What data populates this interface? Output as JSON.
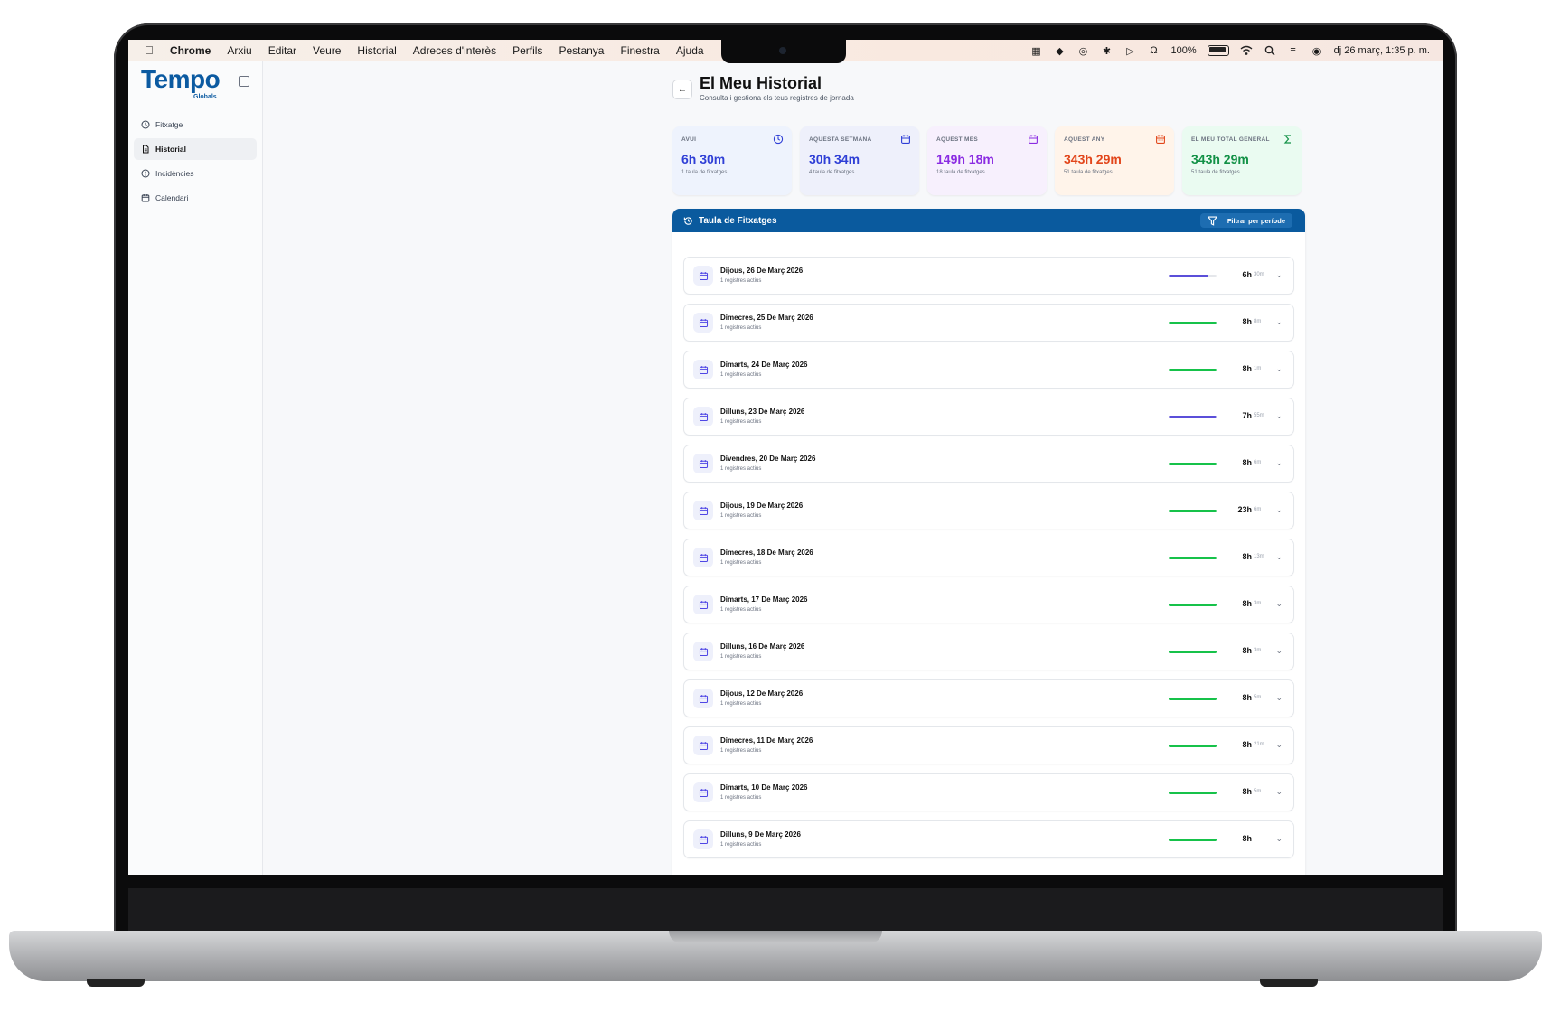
{
  "menubar": {
    "app": "Chrome",
    "items": [
      "Arxiu",
      "Editar",
      "Veure",
      "Historial",
      "Adreces d'interès",
      "Perfils",
      "Pestanya",
      "Finestra",
      "Ajuda"
    ],
    "battery": "100%",
    "datetime": "dj 26 març, 1:35 p. m."
  },
  "sidebar": {
    "logo": "Tempo",
    "logo_sub": "Globals",
    "items": [
      {
        "label": "Fitxatge",
        "icon": "clock-icon"
      },
      {
        "label": "Historial",
        "icon": "file-icon"
      },
      {
        "label": "Incidències",
        "icon": "alert-circle-icon"
      },
      {
        "label": "Calendari",
        "icon": "calendar-icon"
      }
    ]
  },
  "page": {
    "title": "El Meu Historial",
    "subtitle": "Consulta i gestiona els teus registres de jornada"
  },
  "cards": [
    {
      "label": "AVUI",
      "value": "6h 30m",
      "sub": "1 taula de fitxatges",
      "color": "#2f3fd6",
      "bg": "#eef3fd",
      "icon": "clock-icon"
    },
    {
      "label": "AQUESTA SETMANA",
      "value": "30h 34m",
      "sub": "4 taula de fitxatges",
      "color": "#2f3fd6",
      "bg": "#eef0fb",
      "icon": "calendar-icon"
    },
    {
      "label": "AQUEST MES",
      "value": "149h 18m",
      "sub": "18 taula de fitxatges",
      "color": "#8a2be2",
      "bg": "#f7f0fd",
      "icon": "calendar-icon"
    },
    {
      "label": "AQUEST ANY",
      "value": "343h 29m",
      "sub": "51 taula de fitxatges",
      "color": "#e2461b",
      "bg": "#fff4ea",
      "icon": "calendar-days-icon"
    },
    {
      "label": "EL MEU TOTAL GENERAL",
      "value": "343h 29m",
      "sub": "51 taula de fitxatges",
      "color": "#129146",
      "bg": "#eafbf1",
      "icon": "sigma-icon"
    }
  ],
  "panel": {
    "title": "Taula de Fitxatges",
    "filter": "Filtrar per període"
  },
  "rows": [
    {
      "date": "Dijous, 26 De Març 2026",
      "count": "1 registres actius",
      "hours": "6h",
      "minutes": "30m",
      "progress": 0.81,
      "color": "#5b4fd9"
    },
    {
      "date": "Dimecres, 25 De Març 2026",
      "count": "1 registres actius",
      "hours": "8h",
      "minutes": "8m",
      "progress": 1,
      "color": "#16c24a"
    },
    {
      "date": "Dimarts, 24 De Març 2026",
      "count": "1 registres actius",
      "hours": "8h",
      "minutes": "1m",
      "progress": 1,
      "color": "#16c24a"
    },
    {
      "date": "Dilluns, 23 De Març 2026",
      "count": "1 registres actius",
      "hours": "7h",
      "minutes": "55m",
      "progress": 0.99,
      "color": "#5b4fd9"
    },
    {
      "date": "Divendres, 20 De Març 2026",
      "count": "1 registres actius",
      "hours": "8h",
      "minutes": "6m",
      "progress": 1,
      "color": "#16c24a"
    },
    {
      "date": "Dijous, 19 De Març 2026",
      "count": "1 registres actius",
      "hours": "23h",
      "minutes": "6m",
      "progress": 1,
      "color": "#16c24a"
    },
    {
      "date": "Dimecres, 18 De Març 2026",
      "count": "1 registres actius",
      "hours": "8h",
      "minutes": "13m",
      "progress": 1,
      "color": "#16c24a"
    },
    {
      "date": "Dimarts, 17 De Març 2026",
      "count": "1 registres actius",
      "hours": "8h",
      "minutes": "3m",
      "progress": 1,
      "color": "#16c24a"
    },
    {
      "date": "Dilluns, 16 De Març 2026",
      "count": "1 registres actius",
      "hours": "8h",
      "minutes": "3m",
      "progress": 1,
      "color": "#16c24a"
    },
    {
      "date": "Dijous, 12 De Març 2026",
      "count": "1 registres actius",
      "hours": "8h",
      "minutes": "5m",
      "progress": 1,
      "color": "#16c24a"
    },
    {
      "date": "Dimecres, 11 De Març 2026",
      "count": "1 registres actius",
      "hours": "8h",
      "minutes": "21m",
      "progress": 1,
      "color": "#16c24a"
    },
    {
      "date": "Dimarts, 10 De Març 2026",
      "count": "1 registres actius",
      "hours": "8h",
      "minutes": "5m",
      "progress": 1,
      "color": "#16c24a"
    },
    {
      "date": "Dilluns, 9 De Març 2026",
      "count": "1 registres actius",
      "hours": "8h",
      "minutes": "",
      "progress": 1,
      "color": "#16c24a"
    }
  ]
}
